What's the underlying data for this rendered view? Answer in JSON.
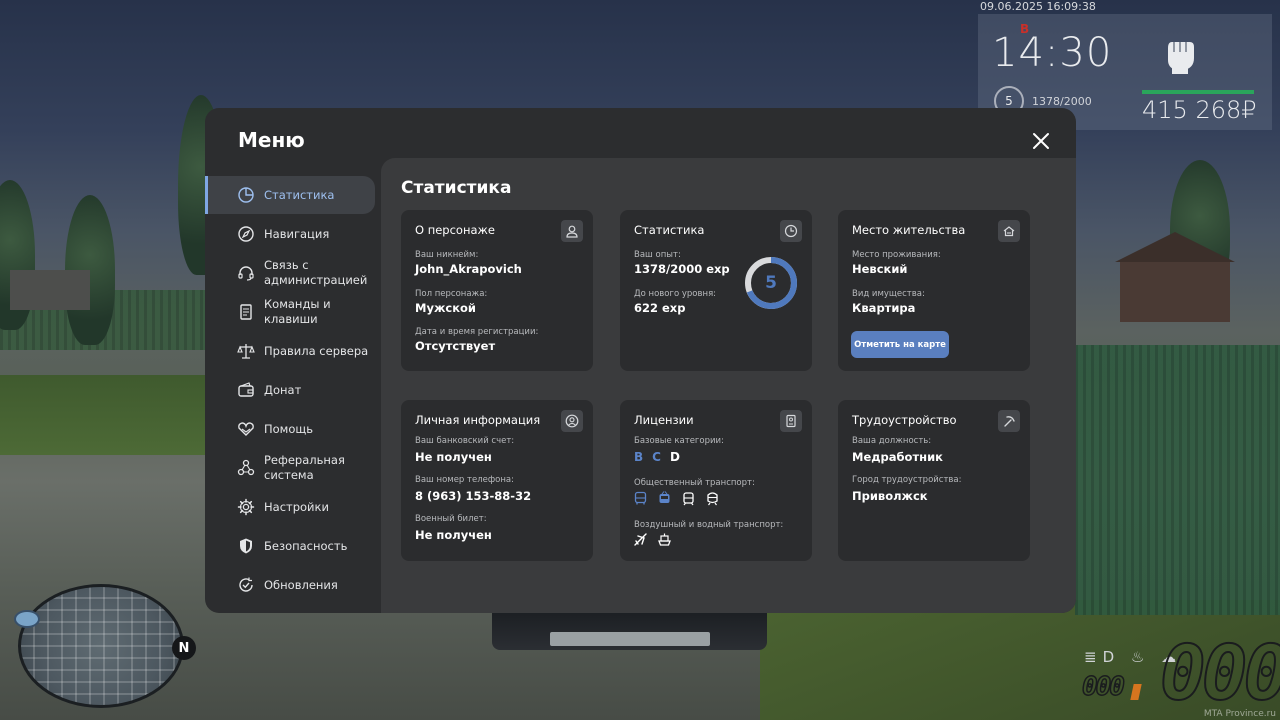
{
  "hud": {
    "datetime": "09.06.2025 16:09:38",
    "time": "14:30",
    "level": "5",
    "exp": "1378/2000",
    "money": "415 268₽",
    "marker": "B",
    "fuel": "000",
    "speed": "000",
    "minimap_north": "N",
    "watermark": "MTA Province.ru"
  },
  "menu": {
    "title": "Меню",
    "sidebar": [
      {
        "label": "Статистика",
        "icon": "pie-chart-icon",
        "active": true
      },
      {
        "label": "Навигация",
        "icon": "compass-icon"
      },
      {
        "label": "Связь с администрацией",
        "icon": "headset-icon"
      },
      {
        "label": "Команды и клавиши",
        "icon": "document-icon"
      },
      {
        "label": "Правила сервера",
        "icon": "scales-icon"
      },
      {
        "label": "Донат",
        "icon": "wallet-icon"
      },
      {
        "label": "Помощь",
        "icon": "heart-hands-icon"
      },
      {
        "label": "Реферальная система",
        "icon": "network-icon"
      },
      {
        "label": "Настройки",
        "icon": "gear-icon"
      },
      {
        "label": "Безопасность",
        "icon": "shield-icon"
      },
      {
        "label": "Обновления",
        "icon": "refresh-check-icon"
      }
    ]
  },
  "stats": {
    "title": "Статистика",
    "character": {
      "title": "О персонаже",
      "nickname_label": "Ваш никнейм:",
      "nickname": "John_Akrapovich",
      "gender_label": "Пол персонажа:",
      "gender": "Мужской",
      "reg_label": "Дата и время регистрации:",
      "reg": "Отсутствует"
    },
    "statistics": {
      "title": "Статистика",
      "exp_label": "Ваш опыт:",
      "exp": "1378/2000 exp",
      "next_label": "До нового уровня:",
      "next": "622 exp",
      "level": "5",
      "progress": 0.689
    },
    "residence": {
      "title": "Место жительства",
      "place_label": "Место проживания:",
      "place": "Невский",
      "property_label": "Вид имущества:",
      "property": "Квартира",
      "map_button": "Отметить на карте"
    },
    "personal": {
      "title": "Личная информация",
      "bank_label": "Ваш банковский счет:",
      "bank": "Не получен",
      "phone_label": "Ваш номер телефона:",
      "phone": "8 (963) 153-88-32",
      "military_label": "Военный билет:",
      "military": "Не получен"
    },
    "licenses": {
      "title": "Лицензии",
      "base_label": "Базовые категории:",
      "cat_b": "B",
      "cat_c": "C",
      "cat_d": "D",
      "public_label": "Общественный транспорт:",
      "air_label": "Воздушный и водный транспорт:"
    },
    "employment": {
      "title": "Трудоустройство",
      "position_label": "Ваша должность:",
      "position": "Медработник",
      "city_label": "Город трудоустройства:",
      "city": "Приволжск"
    }
  },
  "colors": {
    "accent": "#5b84c9",
    "button": "#5a7fbf",
    "panel": "#2c2d2f",
    "card": "#2b2c2e",
    "content": "#3a3b3d"
  }
}
